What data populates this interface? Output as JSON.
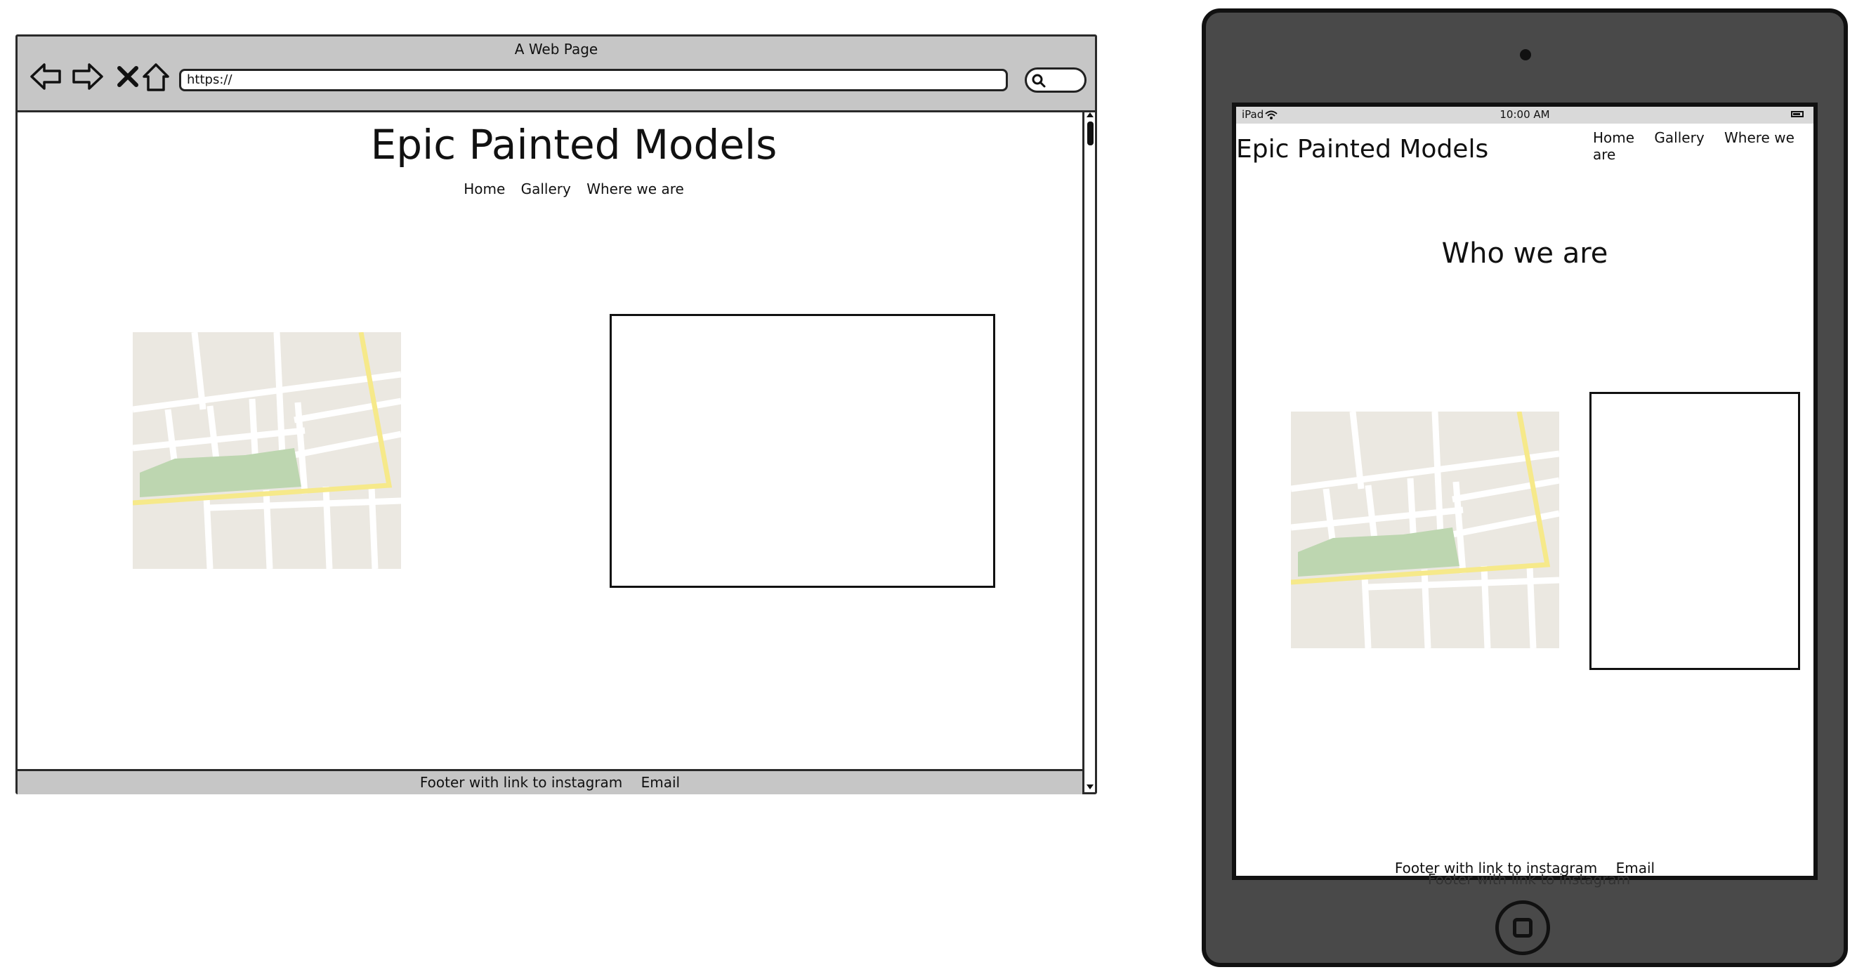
{
  "browser": {
    "window_title": "A Web Page",
    "url": "https://",
    "site_title": "Epic Painted Models",
    "nav": [
      "Home",
      "Gallery",
      "Where we are"
    ],
    "footer": {
      "instagram": "Footer with link to instagram",
      "email": "Email"
    }
  },
  "tablet": {
    "status": {
      "carrier": "iPad",
      "time": "10:00 AM"
    },
    "site_title": "Epic Painted Models",
    "nav": [
      "Home",
      "Gallery",
      "Where we are"
    ],
    "heading": "Who we are",
    "footer": {
      "instagram": "Footer with link to instagram",
      "email": "Email"
    },
    "footer_duplicate": "Footer with link to instagram"
  },
  "colors": {
    "chrome": "#c6c6c6",
    "tablet_body": "#494949",
    "map_land": "#ebe8e1",
    "map_park": "#bdd6b0",
    "map_road": "#f6e98a"
  },
  "icons": [
    "back-arrow-icon",
    "forward-arrow-icon",
    "close-icon",
    "home-icon",
    "search-icon",
    "wifi-icon",
    "battery-icon",
    "map-placeholder-icon"
  ]
}
